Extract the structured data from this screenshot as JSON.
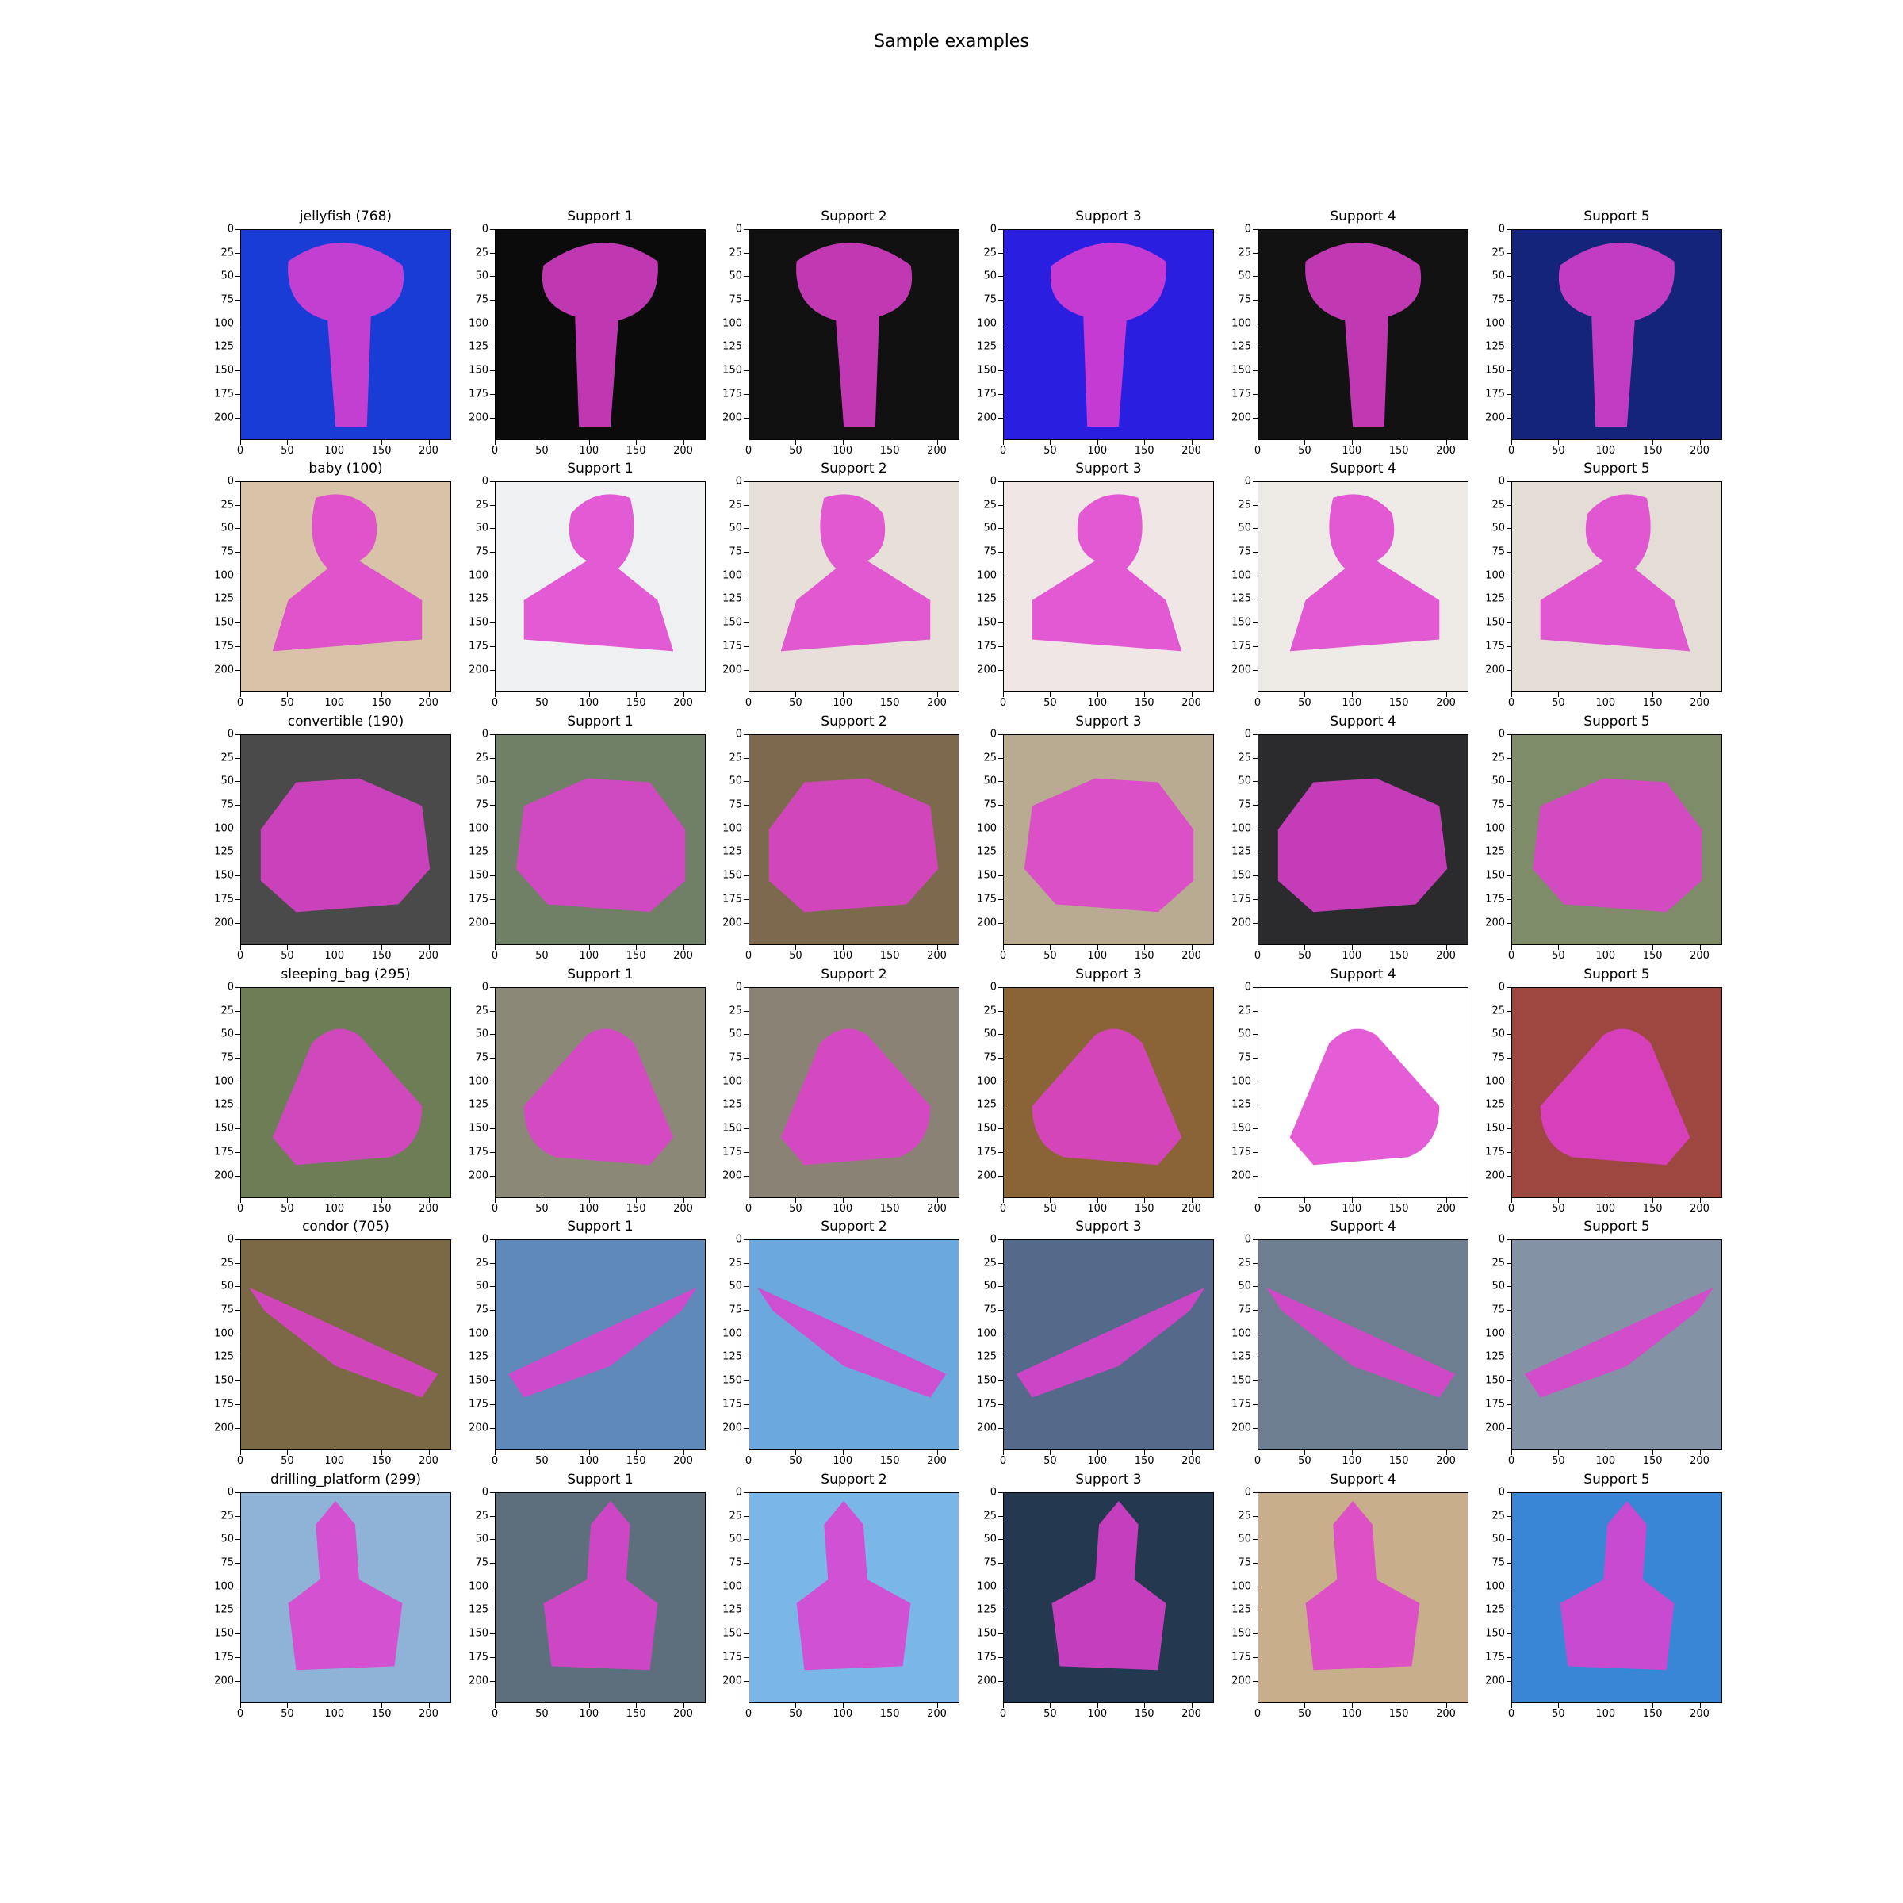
{
  "figure_title": "Sample examples",
  "axes": {
    "y_ticks": [
      "0",
      "25",
      "50",
      "75",
      "100",
      "125",
      "150",
      "175",
      "200"
    ],
    "x_ticks": [
      "0",
      "50",
      "100",
      "150",
      "200"
    ],
    "y_values": [
      0,
      25,
      50,
      75,
      100,
      125,
      150,
      175,
      200
    ],
    "x_values": [
      0,
      50,
      100,
      150,
      200
    ],
    "range": [
      0,
      224
    ]
  },
  "mask_overlay_color": "#e040d0",
  "rows": [
    {
      "query": "jellyfish (768)",
      "supports": [
        "Support 1",
        "Support 2",
        "Support 3",
        "Support 4",
        "Support 5"
      ],
      "backgrounds": [
        "#1a3cd6",
        "#0b0b0b",
        "#111111",
        "#2a1fe0",
        "#121212",
        "#14247a"
      ]
    },
    {
      "query": "baby (100)",
      "supports": [
        "Support 1",
        "Support 2",
        "Support 3",
        "Support 4",
        "Support 5"
      ],
      "backgrounds": [
        "#d9c3a8",
        "#eef0f2",
        "#e6e0d8",
        "#f0e6e6",
        "#eeeae6",
        "#e3ddd6"
      ]
    },
    {
      "query": "convertible (190)",
      "supports": [
        "Support 1",
        "Support 2",
        "Support 3",
        "Support 4",
        "Support 5"
      ],
      "backgrounds": [
        "#4a4a4a",
        "#6f8066",
        "#7d6a4e",
        "#b8ab92",
        "#2b2b2e",
        "#7f8c69"
      ]
    },
    {
      "query": "sleeping_bag (295)",
      "supports": [
        "Support 1",
        "Support 2",
        "Support 3",
        "Support 4",
        "Support 5"
      ],
      "backgrounds": [
        "#6d7d55",
        "#8b8878",
        "#8a8274",
        "#8a6436",
        "#ffffff",
        "#9e4740"
      ]
    },
    {
      "query": "condor (705)",
      "supports": [
        "Support 1",
        "Support 2",
        "Support 3",
        "Support 4",
        "Support 5"
      ],
      "backgrounds": [
        "#7b6845",
        "#5f89b8",
        "#6aa8de",
        "#55698a",
        "#6d7e90",
        "#8492a6"
      ]
    },
    {
      "query": "drilling_platform (299)",
      "supports": [
        "Support 1",
        "Support 2",
        "Support 3",
        "Support 4",
        "Support 5"
      ],
      "backgrounds": [
        "#8fb3d6",
        "#5d6f7c",
        "#7ab7e8",
        "#24384f",
        "#c8ae8a",
        "#3a86d6"
      ]
    }
  ]
}
